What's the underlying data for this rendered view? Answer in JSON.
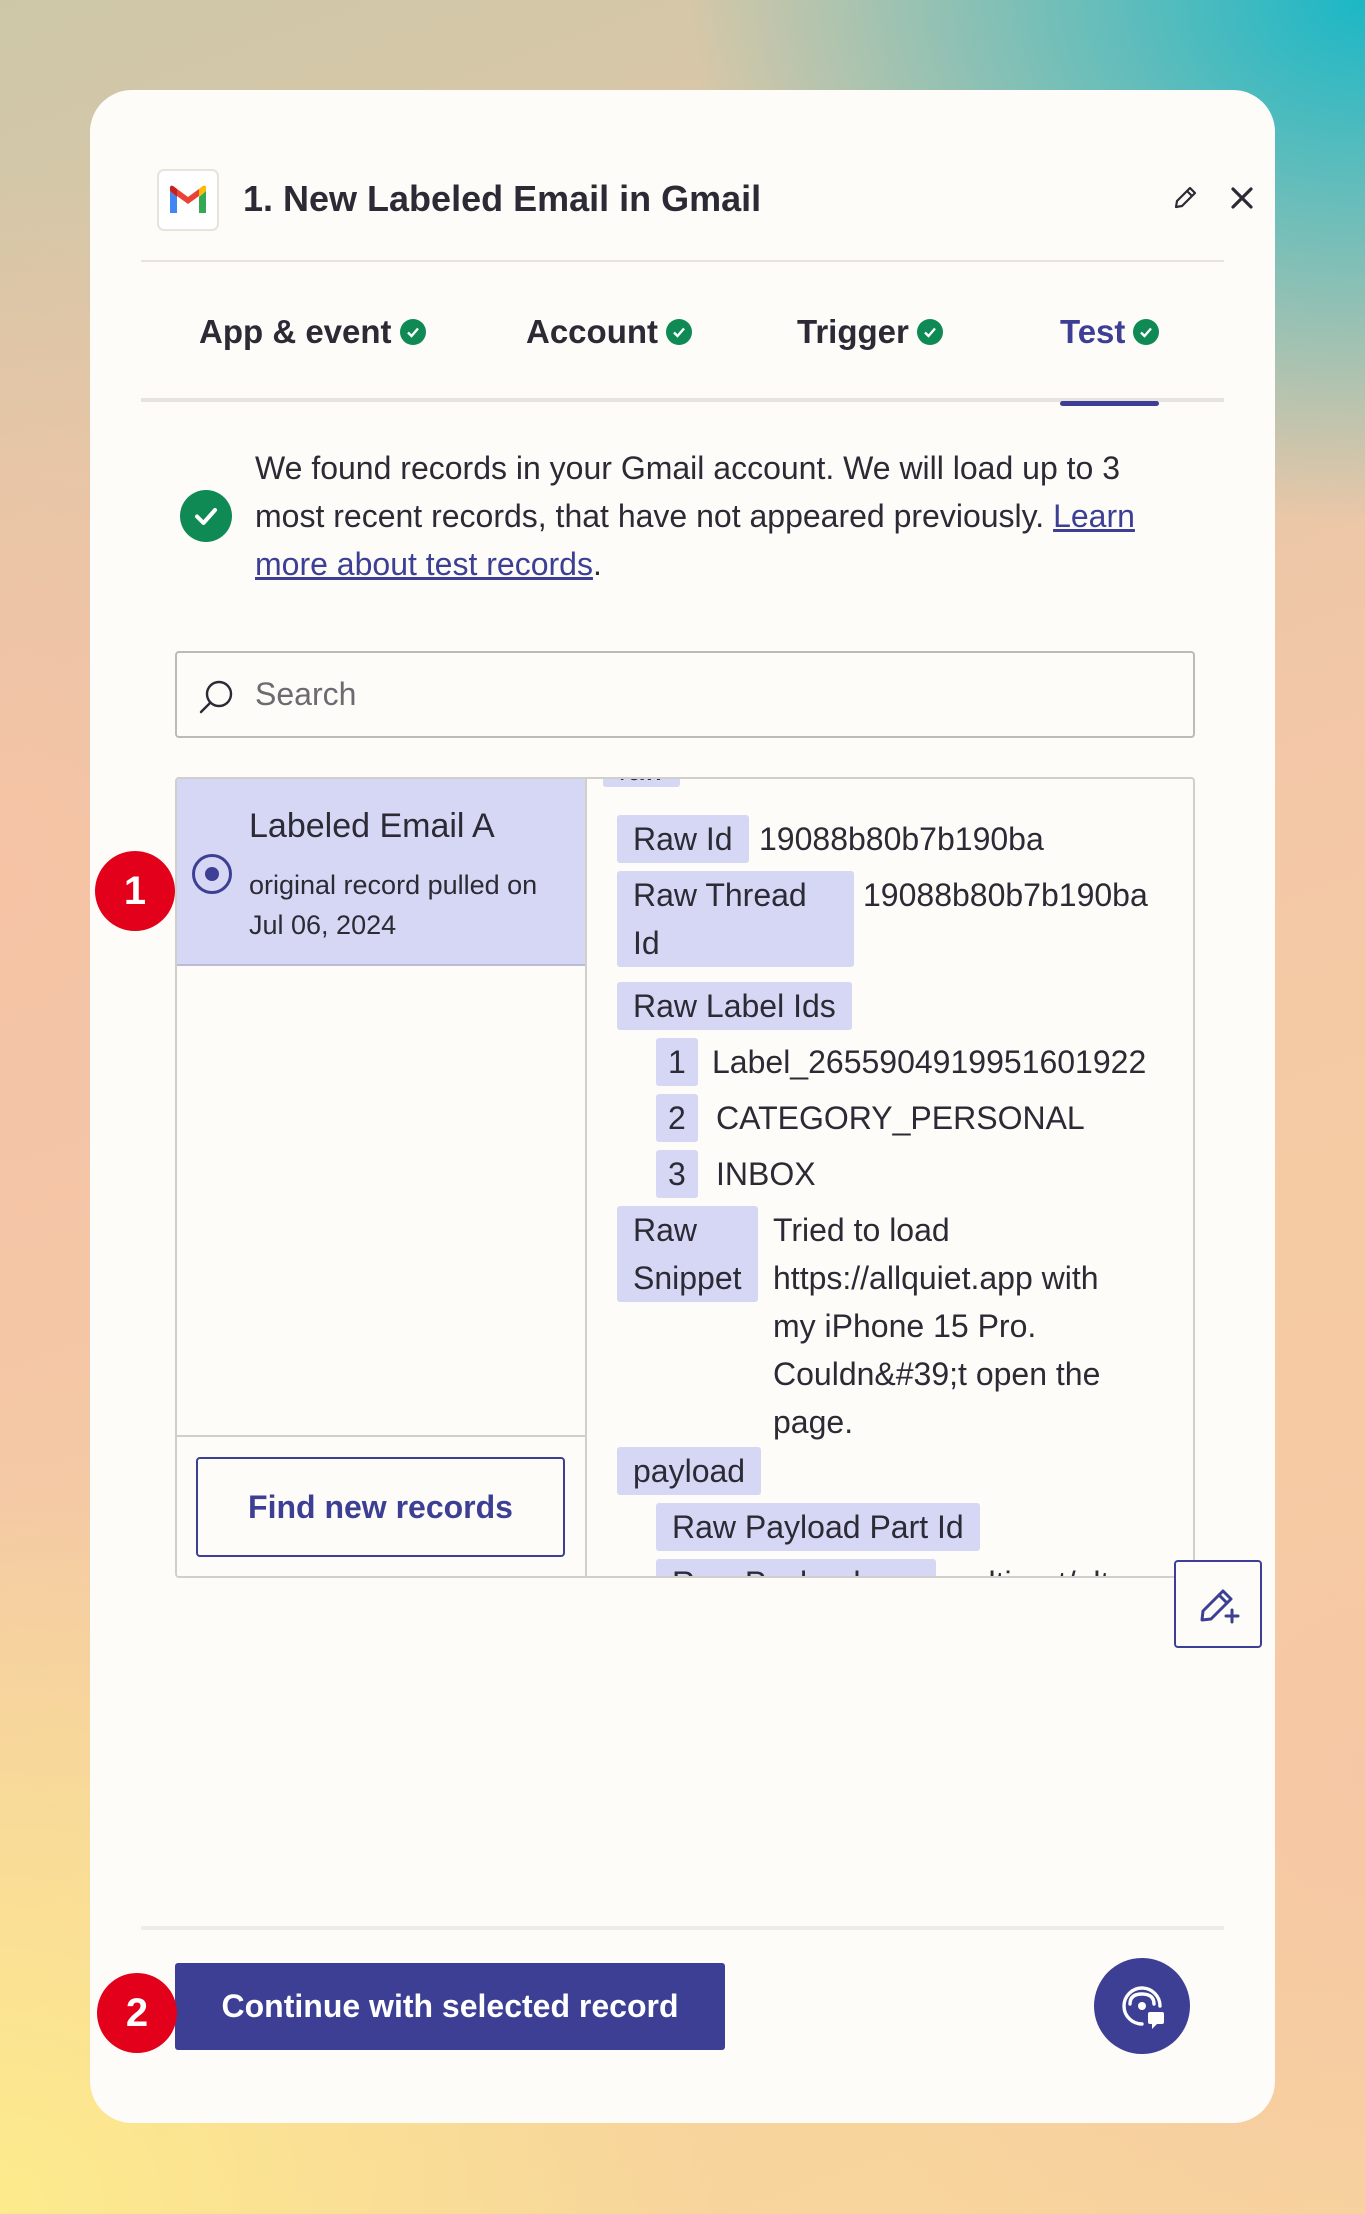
{
  "header": {
    "title": "1. New Labeled Email in Gmail",
    "app_icon": "gmail-logo",
    "actions": [
      "pencil-icon",
      "close-icon"
    ]
  },
  "tabs": [
    {
      "label": "App & event",
      "status": "complete"
    },
    {
      "label": "Account",
      "status": "complete"
    },
    {
      "label": "Trigger",
      "status": "complete"
    },
    {
      "label": "Test",
      "status": "complete",
      "active": true
    }
  ],
  "notice": {
    "text": "We found records in your Gmail account. We will load up to 3 most recent records, that have not appeared previously. ",
    "link": "Learn more about test records",
    "end": "."
  },
  "search": {
    "placeholder": "Search"
  },
  "records": {
    "items": [
      {
        "title": "Labeled Email A",
        "subtitle": "original record pulled on Jul 06, 2024",
        "selected": true
      }
    ],
    "find_button": "Find new records"
  },
  "detail": {
    "section_top": "raw",
    "raw_id_key": "Raw Id",
    "raw_id_val": "19088b80b7b190ba",
    "raw_thread_key_1": "Raw Thread",
    "raw_thread_key_2": "Id",
    "raw_thread_val": "19088b80b7b190ba",
    "raw_label_key": "Raw Label Ids",
    "labels": [
      {
        "index": "1",
        "value": "Label_2655904919951601922"
      },
      {
        "index": "2",
        "value": "CATEGORY_PERSONAL"
      },
      {
        "index": "3",
        "value": "INBOX"
      }
    ],
    "snippet_key_1": "Raw",
    "snippet_key_2": "Snippet",
    "snippet_lines": [
      "Tried to load",
      "https://allquiet.app with",
      "my iPhone 15 Pro.",
      "Couldn&#39;t open the",
      "page."
    ],
    "payload_key": "payload",
    "payload_part_key": "Raw Payload Part Id",
    "payload_next_key": "Raw Payload",
    "payload_next_val": "multipart/alterna"
  },
  "footer": {
    "continue": "Continue with selected record",
    "help_icon": "support-chat-icon"
  },
  "annotations": [
    "1",
    "2"
  ],
  "colors": {
    "accent": "#3d3f94",
    "success": "#0f8a55",
    "highlight": "#d5d7f4",
    "badge": "#e2001a"
  }
}
